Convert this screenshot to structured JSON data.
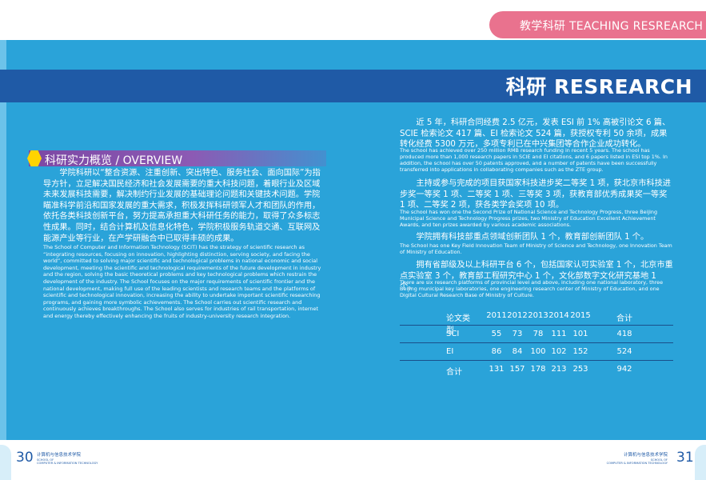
{
  "header": {
    "section_tab": "教学科研 TEACHING RESREARCH",
    "title": "科研 RESREARCH"
  },
  "overview": {
    "title": "科研实力概览 / OVERVIEW",
    "cn": "学院科研以“整合资源、注重创新、突出特色、服务社会、面向国际”为指导方针，立足解决国民经济和社会发展需要的重大科技问题，着眼行业及区域未来发展科技需要，解决制约行业发展的基础理论问题和关键技术问题。学院瞄准科学前沿和国家发展的重大需求，积极发挥科研领军人才和团队的作用，依托各类科技创新平台，努力提高承担重大科研任务的能力，取得了众多标志性成果。同时，结合计算机及信息化特色，学院积极服务轨道交通、互联网及能源产业等行业，在产学研融合中已取得丰硕的成果。",
    "en": "The School of Computer and Information Technology (SCIT) has the strategy of scientific research as “integrating resources, focusing on innovation, highlighting distinction, serving society, and facing the world”, committed to solving major scientific and technological problems in national economic and social development, meeting the scientific and technological requirements of the future development in industry and the region, solving the basic theoretical problems and key technological problems which restrain the development of the industry. The School focuses on the major requirements of scientific frontier and the national development, making full use of the leading scientists and research teams and the platforms of scientific and technological innovation, increasing the ability to undertake important scientific researching programs, and gaining more symbolic achievements. The School carries out scientific research and continuously achieves breakthroughs. The School also serves for industries of rail transportation, internet and energy thereby effectively enhancing the fruits of industry-university research integration."
  },
  "right_paragraphs": [
    {
      "cn": "近 5 年，科研合同经费 2.5 亿元，发表 ESI 前 1% 高被引论文 6 篇、SCIE 检索论文 417 篇、EI 检索论文 524 篇，获授权专利 50 余项，成果转化经费 5300 万元，多项专利已在中兴集团等合作企业成功转化。",
      "en": "The school has achieved over 250 million RMB research funding in recent 5 years. The school has produced more than 1,000 research papers in SCIE and EI citations, and 6 papers listed in ESI top 1%. In addition, the school has over 50 patents approved, and a number of patents have been successfully transferred into applications in collaborating companies such as the ZTE group."
    },
    {
      "cn": "主持或参与完成的项目获国家科技进步奖二等奖 1 项，获北京市科技进步奖一等奖 1 项、二等奖 1 项、三等奖 3 项，获教育部优秀成果奖一等奖 1 项、二等奖 2 项，获各类学会奖项 10 项。",
      "en": "The school has won one the Second Prize of National Science and Technology Progress, three Beijing Municipal Science and Technology Progress prizes, two Ministry of Education Excellent Achievement Awards, and ten prizes awarded by various academic associations."
    },
    {
      "cn": "学院拥有科技部重点领域创新团队 1 个，教育部创新团队 1 个。",
      "en": "The School has one Key Field Innovation Team of Ministry of Science and Technology, one Innovation Team of Ministry of Education."
    },
    {
      "cn": "拥有省部级及以上科研平台 6 个，包括国家认可实验室 1 个，北京市重点实验室 3 个，教育部工程研究中心 1 个，文化部数字文化研究基地 1 个。",
      "en": "There are six research platforms of provincial level and above, including one national laboratory, three Beijing municipal key laboratories, one engineering research center of Ministry of Education, and one Digital Cultural Research Base of Ministry of Culture."
    }
  ],
  "table": {
    "headers": [
      "论文类型",
      "2011",
      "2012",
      "2013",
      "2014",
      "2015",
      "合计"
    ],
    "rows": [
      [
        "SCI",
        "55",
        "73",
        "78",
        "111",
        "101",
        "418"
      ],
      [
        "EI",
        "86",
        "84",
        "100",
        "102",
        "152",
        "524"
      ],
      [
        "合计",
        "131",
        "157",
        "178",
        "213",
        "253",
        "942"
      ]
    ]
  },
  "footer": {
    "page_left": "30",
    "page_right": "31",
    "school_cn": "计算机与信息技术学院",
    "school_en_1": "SCHOOL OF",
    "school_en_2": "COMPUTER & INFORMATION TECHNOLOGY"
  },
  "colors": {
    "panel": "#2aa3d9",
    "title_band": "#1f5aa6",
    "tab": "#e9728e",
    "overview_bar": "#8c5ab4",
    "hex_icon": "#ffd400"
  }
}
